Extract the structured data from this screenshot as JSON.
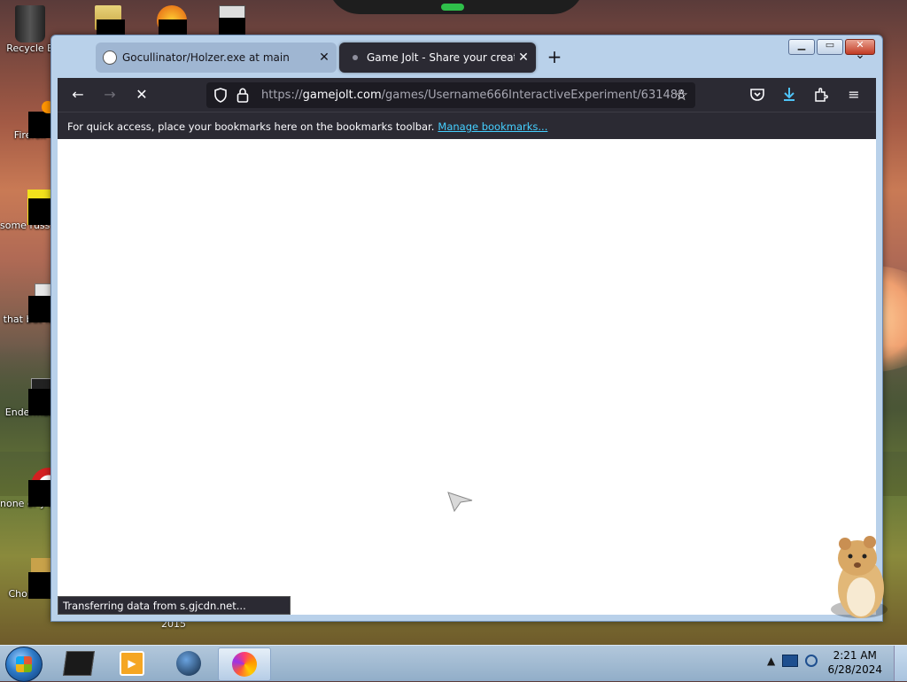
{
  "desktop": {
    "icons": [
      {
        "label": "Recycle B"
      },
      {
        "label": "Firefox"
      },
      {
        "label": "some russ ran a ra"
      },
      {
        "label": "that but its"
      },
      {
        "label": "Enderman"
      },
      {
        "label": "none of y retards kn"
      },
      {
        "label": "ChomikB"
      }
    ],
    "extra_label": "2015"
  },
  "browser": {
    "tabs": [
      {
        "title": "Gocullinator/Holzer.exe at main",
        "active": false
      },
      {
        "title": "Game Jolt - Share your creations",
        "active": true
      }
    ],
    "new_tab": "+",
    "url_host": "gamejolt.com",
    "url_prefix": "https://",
    "url_path": "/games/Username666InteractiveExperiment/631488",
    "bookmarks_message": "For quick access, place your bookmarks here on the bookmarks toolbar.",
    "bookmarks_link": "Manage bookmarks...",
    "status_text": "Transferring data from s.gjcdn.net..."
  },
  "taskbar": {
    "time": "2:21 AM",
    "date": "6/28/2024",
    "active_app": "Firefox"
  },
  "colors": {
    "toolbar": "#2b2a33",
    "urlbar": "#1c1b22",
    "link": "#45cfff",
    "download_icon": "#4fc3f7"
  }
}
